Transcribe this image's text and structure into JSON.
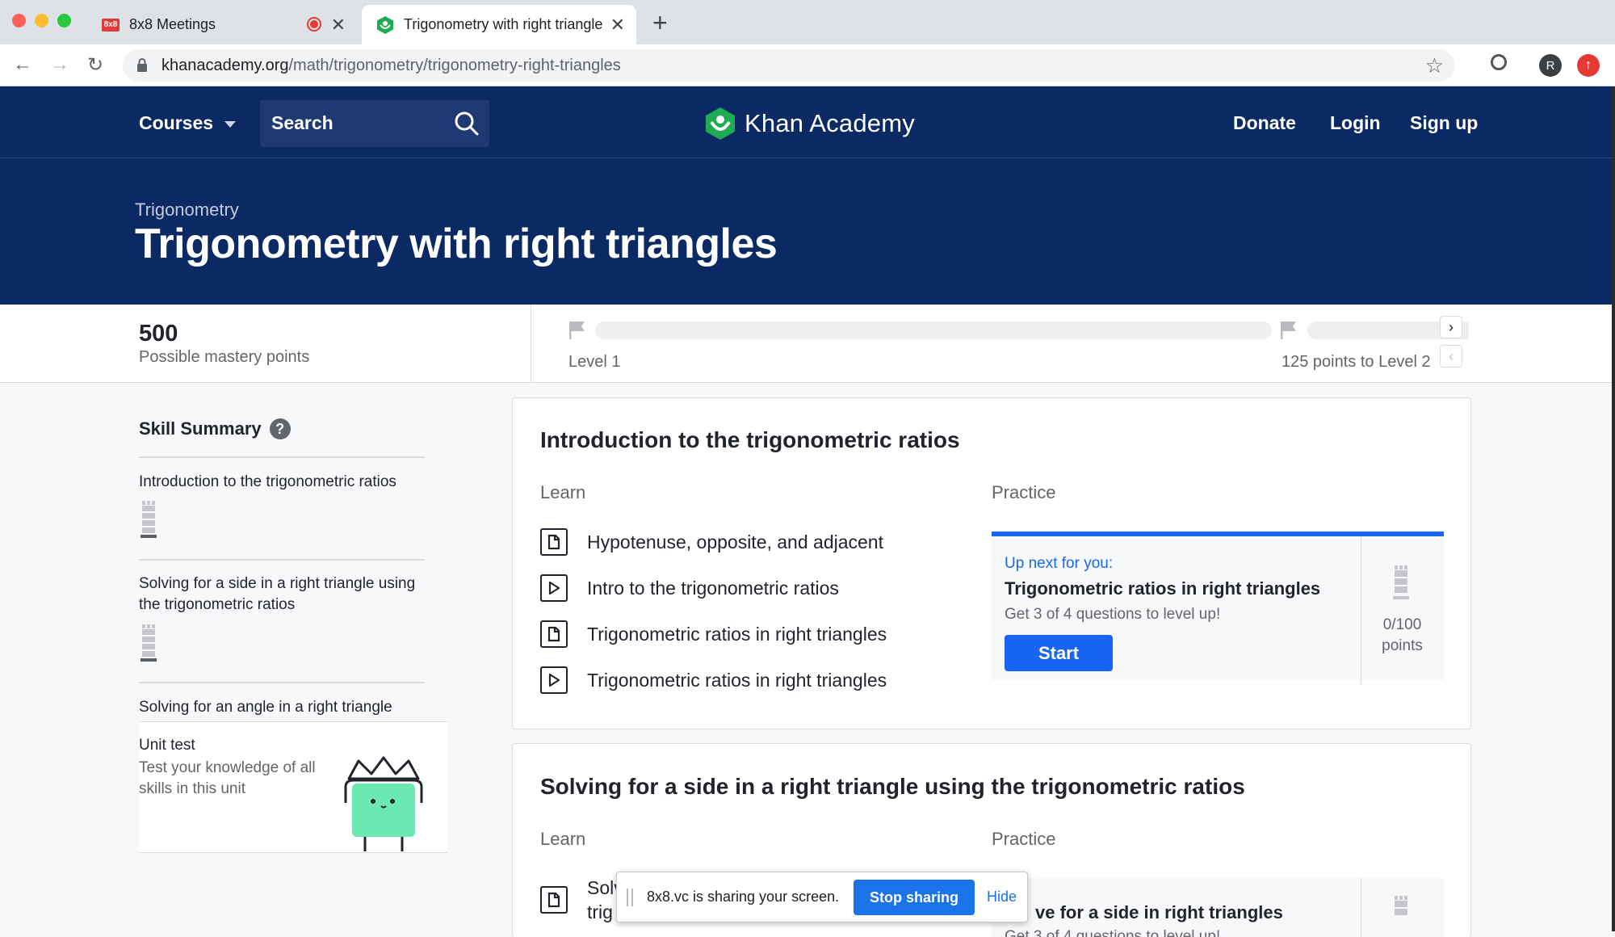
{
  "browser": {
    "tabs": [
      {
        "favicon": "8x8",
        "title": "8x8 Meetings",
        "recording": true
      },
      {
        "title": "Trigonometry with right triangle",
        "active": true
      }
    ],
    "url_domain": "khanacademy.org",
    "url_path": "/math/trigonometry/trigonometry-right-triangles",
    "profile_initial": "R"
  },
  "header": {
    "courses_label": "Courses",
    "search_placeholder": "Search",
    "logo_text": "Khan Academy",
    "donate": "Donate",
    "login": "Login",
    "signup": "Sign up",
    "breadcrumb": "Trigonometry",
    "title": "Trigonometry with right triangles"
  },
  "mastery": {
    "points": "500",
    "points_label": "Possible mastery points",
    "level_label": "Level 1",
    "next_level": "125 points to Level 2"
  },
  "sidebar": {
    "title": "Skill Summary",
    "items": [
      {
        "label": "Introduction to the trigonometric ratios"
      },
      {
        "label": "Solving for a side in a right triangle using the trigonometric ratios"
      },
      {
        "label": "Solving for an angle in a right triangle"
      }
    ],
    "unit_test": {
      "title": "Unit test",
      "desc": "Test your knowledge of all skills in this unit"
    }
  },
  "sections": [
    {
      "title": "Introduction to the trigonometric ratios",
      "learn_label": "Learn",
      "practice_label": "Practice",
      "lessons": [
        {
          "type": "article",
          "title": "Hypotenuse, opposite, and adjacent"
        },
        {
          "type": "video",
          "title": "Intro to the trigonometric ratios"
        },
        {
          "type": "article",
          "title": "Trigonometric ratios in right triangles"
        },
        {
          "type": "video",
          "title": "Trigonometric ratios in right triangles"
        }
      ],
      "practice": {
        "up_next": "Up next for you:",
        "title": "Trigonometric ratios in right triangles",
        "subtitle": "Get 3 of 4 questions to level up!",
        "start": "Start",
        "points_value": "0/100",
        "points_unit": "points"
      }
    },
    {
      "title": "Solving for a side in a right triangle using the trigonometric ratios",
      "learn_label": "Learn",
      "practice_label": "Practice",
      "lessons": [
        {
          "type": "article",
          "title_visible_1": "Solv",
          "title_visible_2": "trig"
        }
      ],
      "practice": {
        "title_visible": "ve for a side in right triangles",
        "subtitle_visible": "Get 3 of 4 questions to level up!"
      }
    }
  ],
  "share_bar": {
    "message": "8x8.vc is sharing your screen.",
    "stop": "Stop sharing",
    "hide": "Hide"
  },
  "colors": {
    "brand_navy": "#0b2a63",
    "primary_blue": "#1865f2",
    "accent_green": "#1fab54"
  }
}
